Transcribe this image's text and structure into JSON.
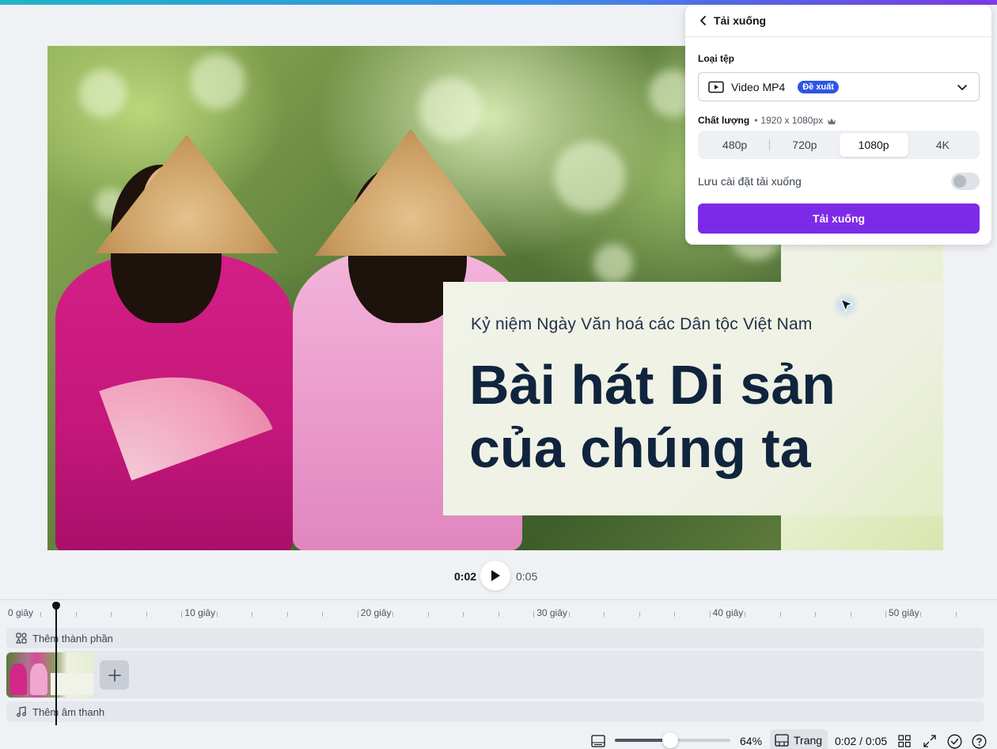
{
  "canvas": {
    "subtitle": "Kỷ niệm Ngày Văn hoá các Dân tộc Việt Nam",
    "title_line1": "Bài hát Di sản",
    "title_line2": "của chúng ta"
  },
  "download_panel": {
    "title": "Tải xuống",
    "file_type_label": "Loại tệp",
    "file_type_value": "Video MP4",
    "file_type_badge": "Đề xuất",
    "quality_label": "Chất lượng",
    "quality_separator": "•",
    "quality_dimensions": "1920 x 1080px",
    "quality_options": [
      "480p",
      "720p",
      "1080p",
      "4K"
    ],
    "quality_selected": "1080p",
    "save_settings_label": "Lưu cài đặt tải xuống",
    "save_settings_on": false,
    "download_button": "Tải xuống"
  },
  "playback": {
    "current_time": "0:02",
    "total_time": "0:05"
  },
  "timeline": {
    "ruler_labels": [
      "0 giây",
      "10 giây",
      "20 giây",
      "30 giây",
      "40 giây",
      "50 giây"
    ],
    "add_element_label": "Thêm thành phần",
    "add_audio_label": "Thêm âm thanh"
  },
  "bottom_bar": {
    "zoom_level": "64%",
    "zoom_fraction": 0.48,
    "page_label": "Trang",
    "time_readout": "0:02 / 0:05"
  },
  "colors": {
    "accent": "#7d2ae8",
    "badge": "#2b55e6"
  }
}
